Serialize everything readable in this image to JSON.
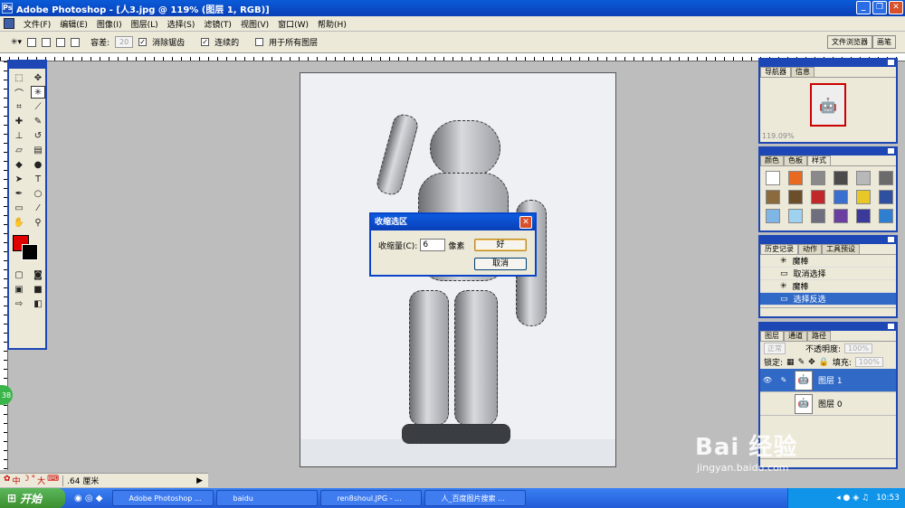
{
  "app": {
    "title": "Adobe Photoshop - [人3.jpg @ 119% (图层 1, RGB)]"
  },
  "menu": [
    "文件(F)",
    "编辑(E)",
    "图像(I)",
    "图层(L)",
    "选择(S)",
    "滤镜(T)",
    "视图(V)",
    "窗口(W)",
    "帮助(H)"
  ],
  "options": {
    "tolerance_label": "容差:",
    "tolerance_value": "20",
    "anti_alias": "消除锯齿",
    "contiguous": "连续的",
    "all_layers": "用于所有图层",
    "well_tabs": [
      "文件浏览器",
      "画笔"
    ]
  },
  "dialog": {
    "title": "收缩选区",
    "label": "收缩量(C):",
    "value": "6",
    "unit": "像素",
    "ok": "好",
    "cancel": "取消"
  },
  "navigator": {
    "tabs": [
      "导航器",
      "信息"
    ],
    "zoom": "119.09%"
  },
  "color_panel": {
    "tabs": [
      "颜色",
      "色板",
      "样式"
    ]
  },
  "styles": [
    "#ffffff",
    "#e86a20",
    "#8a8a8a",
    "#4b4b4b",
    "#b8b8b8",
    "#6b6b6b",
    "#8b6a3e",
    "#6d4e2a",
    "#c0282a",
    "#3a6fd0",
    "#e8c828",
    "#2f4f9f",
    "#7fb6e6",
    "#9fd2f0",
    "#6e6e7e",
    "#6a3fa0",
    "#3a3a9a",
    "#2f7fd0"
  ],
  "history": {
    "tabs": [
      "历史记录",
      "动作",
      "工具预设"
    ],
    "items": [
      "魔棒",
      "取消选择",
      "魔棒",
      "选择反选"
    ]
  },
  "layers": {
    "tabs": [
      "图层",
      "通道",
      "路径"
    ],
    "blend": "正常",
    "opacity_label": "不透明度:",
    "opacity": "100%",
    "lock_label": "锁定:",
    "fill_label": "填充:",
    "fill": "100%",
    "items": [
      "图层 1",
      "图层 0"
    ]
  },
  "status": {
    "ime": [
      "中",
      "°",
      "大"
    ],
    "size": ".64 厘米"
  },
  "taskbar": {
    "start": "开始",
    "tasks": [
      "Adobe Photoshop ...",
      "baidu",
      "ren8shoul.JPG - ...",
      "人_百度图片搜索 ..."
    ],
    "clock": "10:53"
  },
  "watermark": {
    "line1": "Bai 经验",
    "line2": "jingyan.baidu.com"
  },
  "side_badge": "38"
}
